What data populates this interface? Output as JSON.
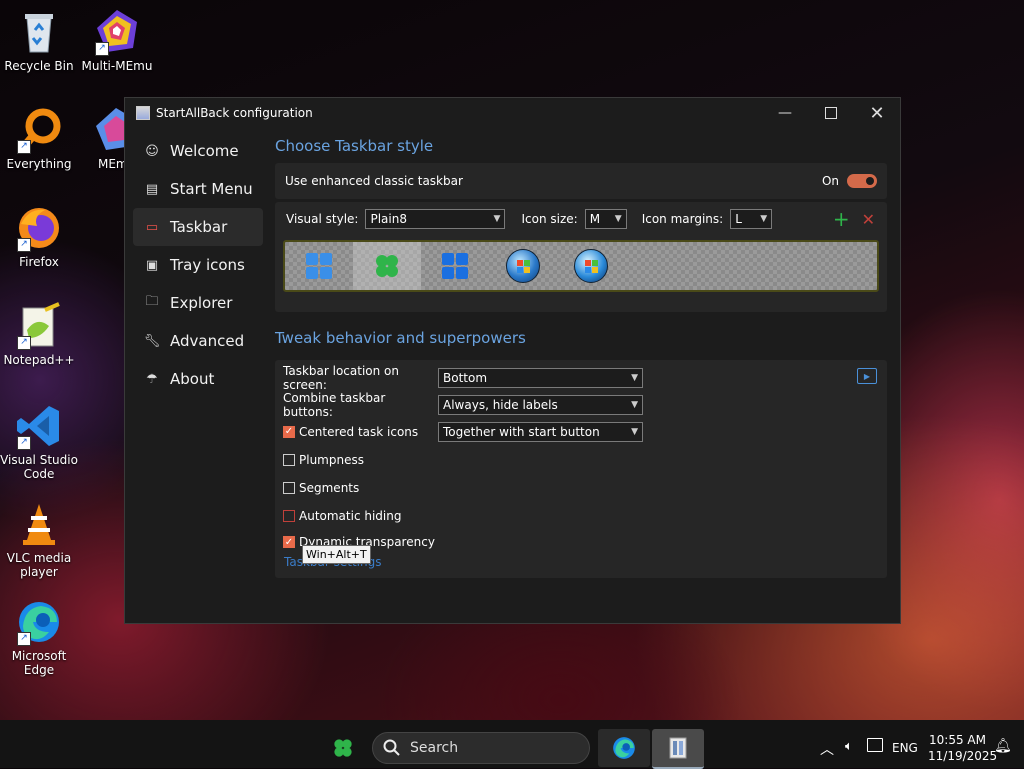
{
  "desktop": {
    "icons": [
      {
        "label": "Recycle Bin"
      },
      {
        "label": "Multi-MEmu"
      },
      {
        "label": "Everything"
      },
      {
        "label": "MEm"
      },
      {
        "label": "Firefox"
      },
      {
        "label": "Notepad++"
      },
      {
        "label": "Visual Studio Code"
      },
      {
        "label": "VLC media player"
      },
      {
        "label": "Microsoft Edge"
      }
    ]
  },
  "window": {
    "title": "StartAllBack configuration",
    "nav": [
      {
        "label": "Welcome",
        "icon": "smile-icon"
      },
      {
        "label": "Start Menu",
        "icon": "start-menu-icon"
      },
      {
        "label": "Taskbar",
        "icon": "taskbar-icon",
        "active": true
      },
      {
        "label": "Tray icons",
        "icon": "tray-icon"
      },
      {
        "label": "Explorer",
        "icon": "folder-icon"
      },
      {
        "label": "Advanced",
        "icon": "wrench-icon"
      },
      {
        "label": "About",
        "icon": "about-icon"
      }
    ],
    "taskbar_style": {
      "section_title": "Choose Taskbar style",
      "enhanced_label": "Use enhanced classic taskbar",
      "enhanced_state": "On",
      "visual_style_label": "Visual style:",
      "visual_style_value": "Plain8",
      "icon_size_label": "Icon size:",
      "icon_size_value": "M",
      "icon_margins_label": "Icon margins:",
      "icon_margins_value": "L"
    },
    "tweaks": {
      "section_title": "Tweak behavior and superpowers",
      "location_label": "Taskbar location on screen:",
      "location_value": "Bottom",
      "combine_label": "Combine taskbar buttons:",
      "combine_value": "Always, hide labels",
      "centered_label": "Centered task icons",
      "centered_value": "Together with start button",
      "plumpness_label": "Plumpness",
      "segments_label": "Segments",
      "autohide_label": "Automatic hiding",
      "transparency_label": "Dynamic transparency",
      "taskbar_settings_link": "Taskbar settings",
      "tooltip": "Win+Alt+T"
    }
  },
  "taskbar": {
    "search_placeholder": "Search",
    "language": "ENG",
    "time": "10:55 AM",
    "date": "11/19/2025"
  }
}
